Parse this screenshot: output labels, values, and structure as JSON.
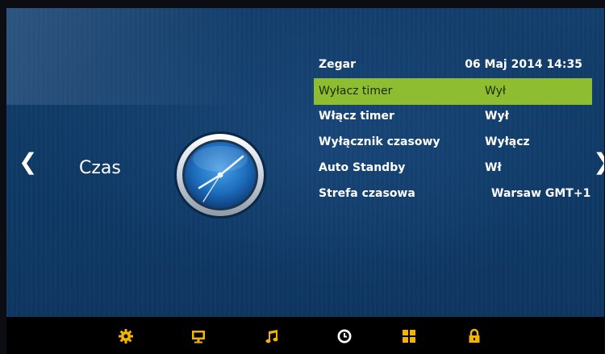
{
  "section": {
    "title": "Czas"
  },
  "menu": {
    "header": {
      "label": "Zegar",
      "value": "06 Maj 2014 14:35"
    },
    "rows": [
      {
        "label": "Wyłacz timer",
        "value": "Wył",
        "selected": true
      },
      {
        "label": "Włącz timer",
        "value": "Wył"
      },
      {
        "label": "Wyłącznik czasowy",
        "value": "Wyłącz"
      },
      {
        "label": "Auto Standby",
        "value": "Wł"
      },
      {
        "label": "Strefa czasowa",
        "value": "Warsaw GMT+1"
      }
    ]
  },
  "nav": {
    "left_arrow": "❮",
    "right_arrow": "❯"
  },
  "bottom_bar": {
    "items": [
      {
        "icon": "settings-gear-icon",
        "active": false
      },
      {
        "icon": "monitor-icon",
        "active": false
      },
      {
        "icon": "music-note-icon",
        "active": false
      },
      {
        "icon": "clock-icon",
        "active": true
      },
      {
        "icon": "apps-grid-icon",
        "active": false
      },
      {
        "icon": "lock-icon",
        "active": false
      }
    ],
    "active_color": "#ffffff",
    "inactive_color": "#f2b400"
  },
  "colors": {
    "selection": "#8fbd32",
    "background": "#0f3a66"
  }
}
